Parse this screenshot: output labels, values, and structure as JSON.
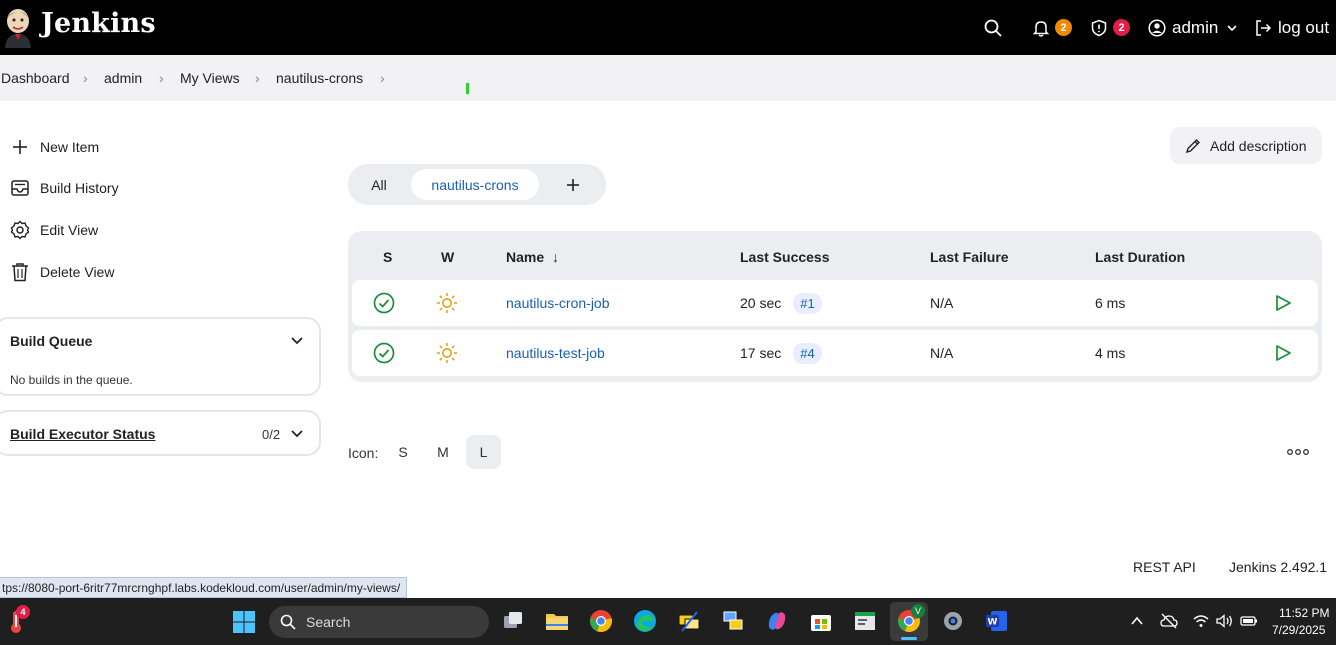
{
  "header": {
    "brand": "Jenkins",
    "notifications_count": "2",
    "security_count": "2",
    "user": "admin",
    "logout_label": "log out"
  },
  "breadcrumb": [
    "Dashboard",
    "admin",
    "My Views",
    "nautilus-crons"
  ],
  "sidebar": {
    "items": [
      {
        "label": "New Item",
        "icon": "plus-icon"
      },
      {
        "label": "Build History",
        "icon": "inbox-icon"
      },
      {
        "label": "Edit View",
        "icon": "gear-icon"
      },
      {
        "label": "Delete View",
        "icon": "trash-icon"
      }
    ],
    "build_queue": {
      "title": "Build Queue",
      "empty_text": "No builds in the queue."
    },
    "executor": {
      "title": "Build Executor Status",
      "count": "0/2"
    }
  },
  "main": {
    "add_description_label": "Add description",
    "tabs": [
      "All",
      "nautilus-crons"
    ],
    "columns": [
      "S",
      "W",
      "Name",
      "Last Success",
      "Last Failure",
      "Last Duration"
    ],
    "sort_indicator": "↓",
    "jobs": [
      {
        "name": "nautilus-cron-job",
        "last_success": "20 sec",
        "build": "#1",
        "last_failure": "N/A",
        "last_duration": "6 ms"
      },
      {
        "name": "nautilus-test-job",
        "last_success": "17 sec",
        "build": "#4",
        "last_failure": "N/A",
        "last_duration": "4 ms"
      }
    ],
    "icon_size": {
      "label": "Icon:",
      "options": [
        "S",
        "M",
        "L"
      ],
      "selected": "L"
    }
  },
  "footer": {
    "rest_api": "REST API",
    "version": "Jenkins 2.492.1"
  },
  "status_url": "tps://8080-port-6ritr77mrcrnghpf.labs.kodekloud.com/user/admin/my-views/",
  "taskbar": {
    "search_label": "Search",
    "weather_badge": "4",
    "time": "11:52 PM",
    "date": "7/29/2025"
  },
  "colors": {
    "success": "#1e8e3e",
    "weather": "#e0a31a",
    "link": "#1a5fb4",
    "notif_badge": "#f08a00",
    "security_badge": "#e11d48"
  }
}
